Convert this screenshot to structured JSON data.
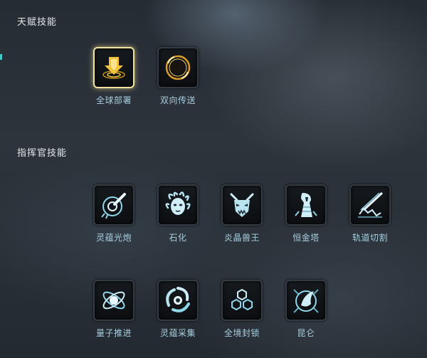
{
  "talent_section": {
    "title": "天赋技能",
    "skills": [
      {
        "label": "全球部署",
        "icon": "global-deploy-icon",
        "selected": true
      },
      {
        "label": "双向传送",
        "icon": "bidirectional-teleport-icon",
        "selected": false
      }
    ]
  },
  "commander_section": {
    "title": "指挥官技能",
    "skills": [
      {
        "label": "灵蕴光炮",
        "icon": "spirit-cannon-icon"
      },
      {
        "label": "石化",
        "icon": "petrify-medusa-icon"
      },
      {
        "label": "炎晶兽王",
        "icon": "flame-crystal-beast-king-icon"
      },
      {
        "label": "恒金塔",
        "icon": "eternal-gold-tower-icon"
      },
      {
        "label": "轨道切割",
        "icon": "orbital-cut-icon"
      },
      {
        "label": "量子推进",
        "icon": "quantum-propulsion-icon"
      },
      {
        "label": "灵蕴采集",
        "icon": "spirit-harvest-icon"
      },
      {
        "label": "全境封锁",
        "icon": "total-lockdown-icon"
      },
      {
        "label": "昆仑",
        "icon": "kunlun-icon"
      }
    ]
  },
  "colors": {
    "label_blue": "#a8cfe0",
    "icon_cyan": "#8fd6ea",
    "gold": "#f2c23a",
    "selected_border": "#f1e3a0"
  }
}
